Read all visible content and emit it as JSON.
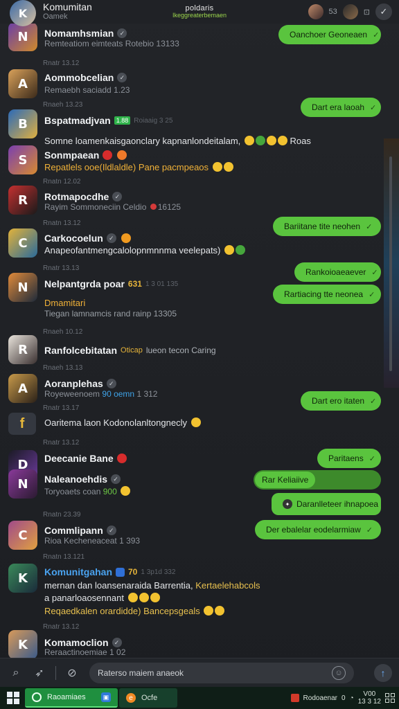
{
  "header": {
    "title": "Komumitan",
    "subtitle": "Oamek",
    "center_title": "poldaris",
    "center_sub": "Ikeggreaterbemaen",
    "count": "53"
  },
  "messages": {
    "r1": {
      "name": "Nomamhsmian",
      "sub": "Remteatiom eimteats Rotebio 13133"
    },
    "t1": "Rnatr 13.12",
    "r2": {
      "name": "Aommobcelian",
      "sub": "Remaebh saciadd 1.23"
    },
    "t2": "Rnaeh 13.23",
    "r3": {
      "name": "Bspatmadjvan",
      "tag": "1.88",
      "meta": "Roiaaig 3 25"
    },
    "l3": "Somne loamenkaisgaonclary kapnanlondeitalam,",
    "l3b": "Roas",
    "r4": {
      "name": "Sonmpaean"
    },
    "l4": "Repatlels ooe(Ildlaldle) Pane pacmpeaos",
    "t4": "Rnatn 12.02",
    "r5": {
      "name": "Rotmapocdhe",
      "sub": "Rayim Sommoneciin Celdio",
      "meta": "16125"
    },
    "t5": "Rnatn 13.12",
    "r6": {
      "name": "Carkocoelun"
    },
    "l6": "Anapeofantmengcalolopnmnnma veelepats)",
    "t6": "Rnatr 13.13",
    "r7": {
      "name": "Nelpantgrda poar",
      "tag": "631",
      "meta": "1 3 01 135"
    },
    "l7": "Dmamitari",
    "l7b": "Tiegan lamnamcis rand rainp 13305",
    "t7": "Rnaeh 10.12",
    "r8": {
      "name": "Ranfolcebitatan",
      "tag": "Oticap",
      "meta": "lueon tecon Caring"
    },
    "t8": "Rnaeh 13.13",
    "r9": {
      "name": "Aoranplehas",
      "sub": "Royeweenoem",
      "tag": "90 oemn",
      "meta": "1 312"
    },
    "t9": "Rnatr 13.17",
    "l9": "Oaritema laon Kodonolanltongnecly",
    "t10": "Rnatr 13.12",
    "r10": {
      "name": "Deecanie Bane"
    },
    "r11": {
      "name": "Naleanoehdis",
      "sub": "Toryoaets coan",
      "tag": "900"
    },
    "t11": "Rnatn 23.39",
    "r12": {
      "name": "Commlipann",
      "sub": "Rioa Kecheneaceat 1 393"
    },
    "t12": "Rnatn 13.121",
    "r13": {
      "name": "Komunitgahan",
      "tag": "70",
      "meta": "1 3p1d 332"
    },
    "l13": "mernan dan loansenaraida Barrentia,",
    "l13b": "Kertaelehabcols",
    "l13c": "a panarloaosennant",
    "l13d": "Reqaedkalen orardidde) Bancepsgeals",
    "t13": "Rnatr 13.12",
    "r14": {
      "name": "Komamoclion",
      "sub": "Reraactinoemiae 1 02"
    }
  },
  "bubbles": [
    "Oanchoer Geoneaen",
    "Dart era laoah",
    "Bariitane tite neohen",
    "Rankoioaeaever",
    "Rartiacing tte neonea",
    "Dart ero itaten",
    "Paritaens",
    "Rar Keliaiive",
    "Daranlleteer ihnapoea",
    "Der ebalelar eodelarmiaw"
  ],
  "input": {
    "placeholder": "Raterso maiem anaeok"
  },
  "taskbar": {
    "app1": "Raoamiaes",
    "app2": "Ocfe",
    "tray_label": "Rodoaenar",
    "tray_num": "0",
    "time1": "V00",
    "time2": "13 3 12"
  },
  "colors": {
    "accent_green": "#5ac43e",
    "background": "#1b1d21",
    "taskbar": "#0f1e17"
  }
}
